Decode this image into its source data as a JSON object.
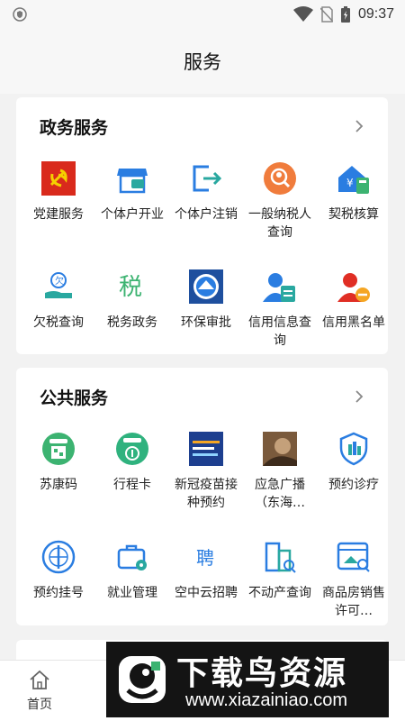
{
  "status_bar": {
    "time": "09:37"
  },
  "header": {
    "title": "服务"
  },
  "sections": [
    {
      "title": "政务服务",
      "items": [
        {
          "label": "党建服务",
          "icon": "party-flag-icon"
        },
        {
          "label": "个体户开业",
          "icon": "storefront-icon"
        },
        {
          "label": "个体户注销",
          "icon": "exit-icon"
        },
        {
          "label": "一般纳税人查询",
          "icon": "search-person-icon"
        },
        {
          "label": "契税核算",
          "icon": "house-calculator-icon"
        },
        {
          "label": "欠税查询",
          "icon": "hand-coin-icon"
        },
        {
          "label": "税务政务",
          "icon": "tax-icon"
        },
        {
          "label": "环保审批",
          "icon": "environment-seal-icon"
        },
        {
          "label": "信用信息查询",
          "icon": "credit-info-icon"
        },
        {
          "label": "信用黑名单",
          "icon": "blacklist-icon"
        }
      ]
    },
    {
      "title": "公共服务",
      "items": [
        {
          "label": "苏康码",
          "icon": "health-code-icon"
        },
        {
          "label": "行程卡",
          "icon": "trip-card-icon"
        },
        {
          "label": "新冠疫苗接种预约",
          "icon": "vaccine-banner-icon"
        },
        {
          "label": "应急广播（东海…",
          "icon": "broadcast-photo-icon"
        },
        {
          "label": "预约诊疗",
          "icon": "shield-clinic-icon"
        },
        {
          "label": "预约挂号",
          "icon": "who-emblem-icon"
        },
        {
          "label": "就业管理",
          "icon": "briefcase-gear-icon"
        },
        {
          "label": "空中云招聘",
          "icon": "recruit-icon"
        },
        {
          "label": "不动产查询",
          "icon": "building-search-icon"
        },
        {
          "label": "商品房销售许可…",
          "icon": "house-search-icon"
        }
      ]
    }
  ],
  "bottom_nav": [
    {
      "label": "首页",
      "icon": "home-icon"
    }
  ],
  "watermark": {
    "title": "下载鸟资源",
    "url": "www.xiazainiao.com"
  },
  "colors": {
    "red": "#e02e24",
    "blue": "#2a7de1",
    "green": "#3cb371",
    "teal": "#29a8a0",
    "orange": "#f07c3c"
  }
}
